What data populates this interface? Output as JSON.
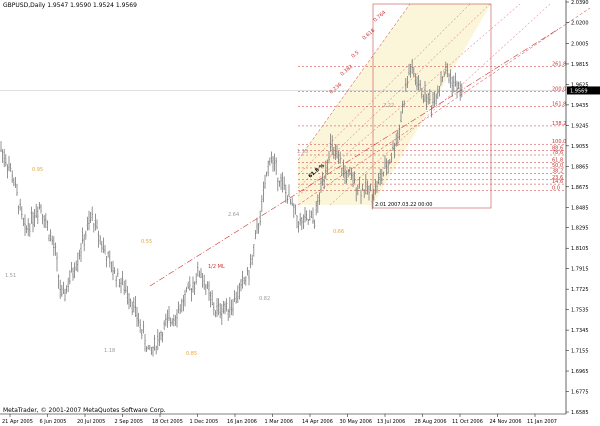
{
  "window": {
    "title": "GBPUSD,Daily  1.9547 1.9590 1.9524 1.9569",
    "copyright": "MetaTrader, © 2001-2007 MetaQuotes Software Corp."
  },
  "chart_data": {
    "type": "bar",
    "symbol": "GBPUSD",
    "timeframe": "Daily",
    "y_ticks": [
      "2.0390",
      "2.0200",
      "2.0005",
      "1.9815",
      "1.9625",
      "1.9435",
      "1.9245",
      "1.9055",
      "1.8865",
      "1.8675",
      "1.8485",
      "1.8295",
      "1.8105",
      "1.7915",
      "1.7725",
      "1.7535",
      "1.7345",
      "1.7155",
      "1.6965",
      "1.6775",
      "1.6585"
    ],
    "x_ticks": [
      "21 Apr 2005",
      "6 Jun 2005",
      "20 Jul 2005",
      "2 Sep 2005",
      "18 Oct 2005",
      "1 Dec 2005",
      "16 Jan 2006",
      "1 Mar 2006",
      "14 Apr 2006",
      "30 May 2006",
      "13 Jul 2006",
      "28 Aug 2006",
      "11 Oct 2006",
      "24 Nov 2006",
      "11 Jan 2007"
    ],
    "current_price": "1.9569",
    "current_price_value": 1.9569,
    "ylim": [
      1.6585,
      2.039
    ],
    "fib_levels": [
      {
        "label": "261.8",
        "value": 1.979
      },
      {
        "label": "200.0",
        "value": 1.956
      },
      {
        "label": "161.8",
        "value": 1.942
      },
      {
        "label": "138.2",
        "value": 1.924
      },
      {
        "label": "100.0",
        "value": 1.907
      },
      {
        "label": "88.6",
        "value": 1.901
      },
      {
        "label": "78.6",
        "value": 1.897
      },
      {
        "label": "61.8",
        "value": 1.89
      },
      {
        "label": "50.0",
        "value": 1.885
      },
      {
        "label": "38.2",
        "value": 1.88
      },
      {
        "label": "23.6",
        "value": 1.874
      },
      {
        "label": "14.6",
        "value": 1.87
      },
      {
        "label": "0.0",
        "value": 1.864
      }
    ],
    "fan_labels": [
      "0.764",
      "0.618",
      "0.5",
      "0.382",
      "0.236"
    ],
    "annotations": [
      {
        "text": "2.22",
        "color": "#999999"
      },
      {
        "text": "1.15",
        "color": "#999999"
      },
      {
        "text": "1.51",
        "color": "#999999"
      },
      {
        "text": "1.18",
        "color": "#999999"
      },
      {
        "text": "0.82",
        "color": "#999999"
      },
      {
        "text": "2.64",
        "color": "#999999"
      },
      {
        "text": "0.95",
        "color": "#e8a33a"
      },
      {
        "text": "0.55",
        "color": "#e8a33a"
      },
      {
        "text": "0.85",
        "color": "#e8a33a"
      },
      {
        "text": "0.66",
        "color": "#e8a33a"
      }
    ],
    "ml_label": "1/2 ML",
    "fib_time_label": "61.8 %",
    "point_label": "2:01  2007.03.22 00:00"
  },
  "colors": {
    "bars": "#7a7a7a",
    "fib": "#cc3333",
    "zone": "#fbf6d9",
    "frame": "#cc6666"
  }
}
